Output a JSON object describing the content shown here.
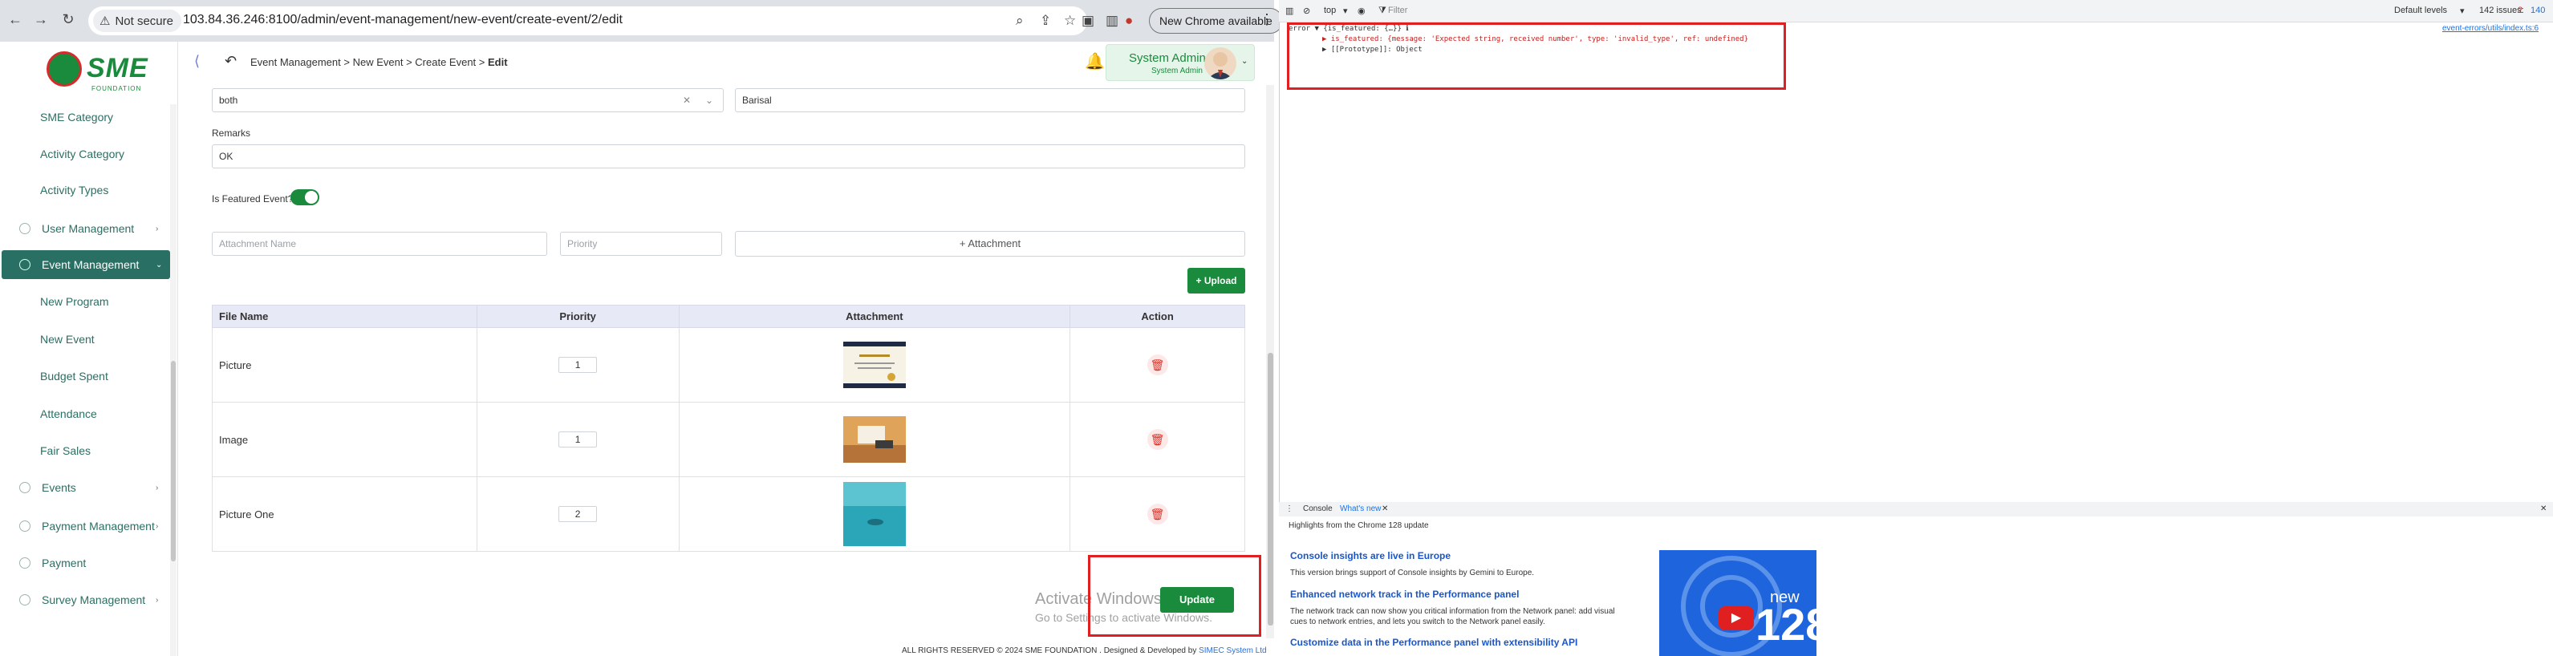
{
  "browser": {
    "not_secure": "Not secure",
    "url": "103.84.36.246:8100/admin/event-management/new-event/create-event/2/edit",
    "new_chrome": "New Chrome available"
  },
  "sidebar": {
    "logo_text": "SME",
    "logo_sub": "FOUNDATION",
    "sub_items": [
      {
        "label": "SME Category"
      },
      {
        "label": "Activity Category"
      },
      {
        "label": "Activity Types"
      }
    ],
    "user_management": "User Management",
    "event_management": "Event Management",
    "event_sub_items": [
      {
        "label": "New Program"
      },
      {
        "label": "New Event"
      },
      {
        "label": "Budget Spent"
      },
      {
        "label": "Attendance"
      },
      {
        "label": "Fair Sales"
      }
    ],
    "events": "Events",
    "payment_management": "Payment Management",
    "payment": "Payment",
    "survey_management": "Survey Management"
  },
  "topbar": {
    "crumb_1": "Event Management",
    "crumb_2": "New Event",
    "crumb_3": "Create Event",
    "crumb_4": "Edit",
    "sep": ">",
    "user_name": "System Admin",
    "user_role": "System Admin"
  },
  "form": {
    "select_value": "both",
    "division_value": "Barisal",
    "remarks_label": "Remarks",
    "remarks_value": "OK",
    "featured_label": "Is Featured Event?",
    "featured_on": true,
    "attachment_name_ph": "Attachment Name",
    "priority_ph": "Priority",
    "attachment_btn": "+ Attachment",
    "upload_btn": "Upload"
  },
  "table": {
    "headers": [
      "File Name",
      "Priority",
      "Attachment",
      "Action"
    ],
    "rows": [
      {
        "file": "Picture",
        "priority": "1"
      },
      {
        "file": "Image",
        "priority": "1"
      },
      {
        "file": "Picture One",
        "priority": "2"
      }
    ]
  },
  "update_btn": "Update",
  "watermark": {
    "line1": "Activate Windows",
    "line2": "Go to Settings to activate Windows."
  },
  "footer": {
    "text": "ALL RIGHTS RESERVED © 2024 SME FOUNDATION . Designed & Developed by",
    "dev": "SIMEC System Ltd"
  },
  "devtools": {
    "context": "top",
    "filter_ph": "Filter",
    "levels": "Default levels",
    "issues": "142 issues:",
    "issue_counts": [
      "2",
      "140"
    ],
    "error_line": "error ▼ {is_featured: {…}} ℹ",
    "detail_line": "▶ is_featured: {message: 'Expected string, received number', type: 'invalid_type', ref: undefined}",
    "proto_line": "▶ [[Prototype]]: Object",
    "source_link": "event-errors/utils/index.ts:6",
    "tabs": [
      "Console",
      "What's new"
    ],
    "whatsnew_sub": "Highlights from the Chrome 128 update",
    "items": [
      {
        "title": "Console insights are live in Europe",
        "text": "This version brings support of Console insights by Gemini to Europe."
      },
      {
        "title": "Enhanced network track in the Performance panel",
        "text": "The network track can now show you critical information from the Network panel: add visual cues to network entries, and lets you switch to the Network panel easily."
      },
      {
        "title": "Customize data in the Performance panel with extensibility API",
        "text": ""
      }
    ],
    "video_new": "new",
    "video_num": "128"
  },
  "colors": {
    "brand_green": "#1a8a3c",
    "sidebar_active": "#2a6f63",
    "highlight_red": "#e02020"
  }
}
